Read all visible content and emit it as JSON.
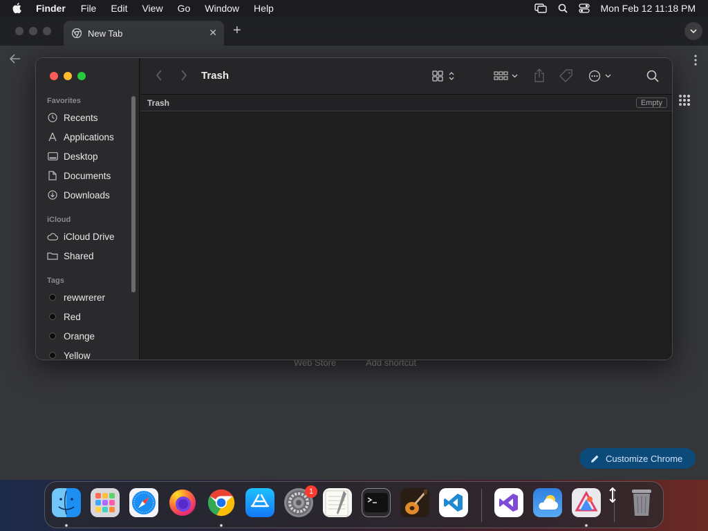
{
  "menubar": {
    "app_name": "Finder",
    "items": [
      "File",
      "Edit",
      "View",
      "Go",
      "Window",
      "Help"
    ],
    "clock": "Mon Feb 12  11:18 PM"
  },
  "chrome": {
    "tab_title": "New Tab",
    "shortcut_labels": [
      "Web Store",
      "Add shortcut"
    ],
    "customize_label": "Customize Chrome",
    "accent_color": "#0b4a79"
  },
  "finder": {
    "title": "Trash",
    "path_title": "Trash",
    "empty_label": "Empty",
    "sidebar": {
      "favorites_header": "Favorites",
      "favorites": [
        "Recents",
        "Applications",
        "Desktop",
        "Documents",
        "Downloads"
      ],
      "icloud_header": "iCloud",
      "icloud": [
        "iCloud Drive",
        "Shared"
      ],
      "tags_header": "Tags",
      "tags": [
        "rewwrerer",
        "Red",
        "Orange",
        "Yellow"
      ]
    },
    "traffic_colors": [
      "#ff5f57",
      "#febc2e",
      "#28c840"
    ]
  },
  "dock": {
    "apps": [
      "Finder",
      "Launchpad",
      "Safari",
      "Firefox",
      "Chrome",
      "App Store",
      "System Settings",
      "TextEdit",
      "Terminal",
      "GarageBand",
      "Visual Studio Code",
      "Visual Studio",
      "Weather",
      "Affinity",
      "Trash"
    ],
    "settings_badge": "1"
  }
}
